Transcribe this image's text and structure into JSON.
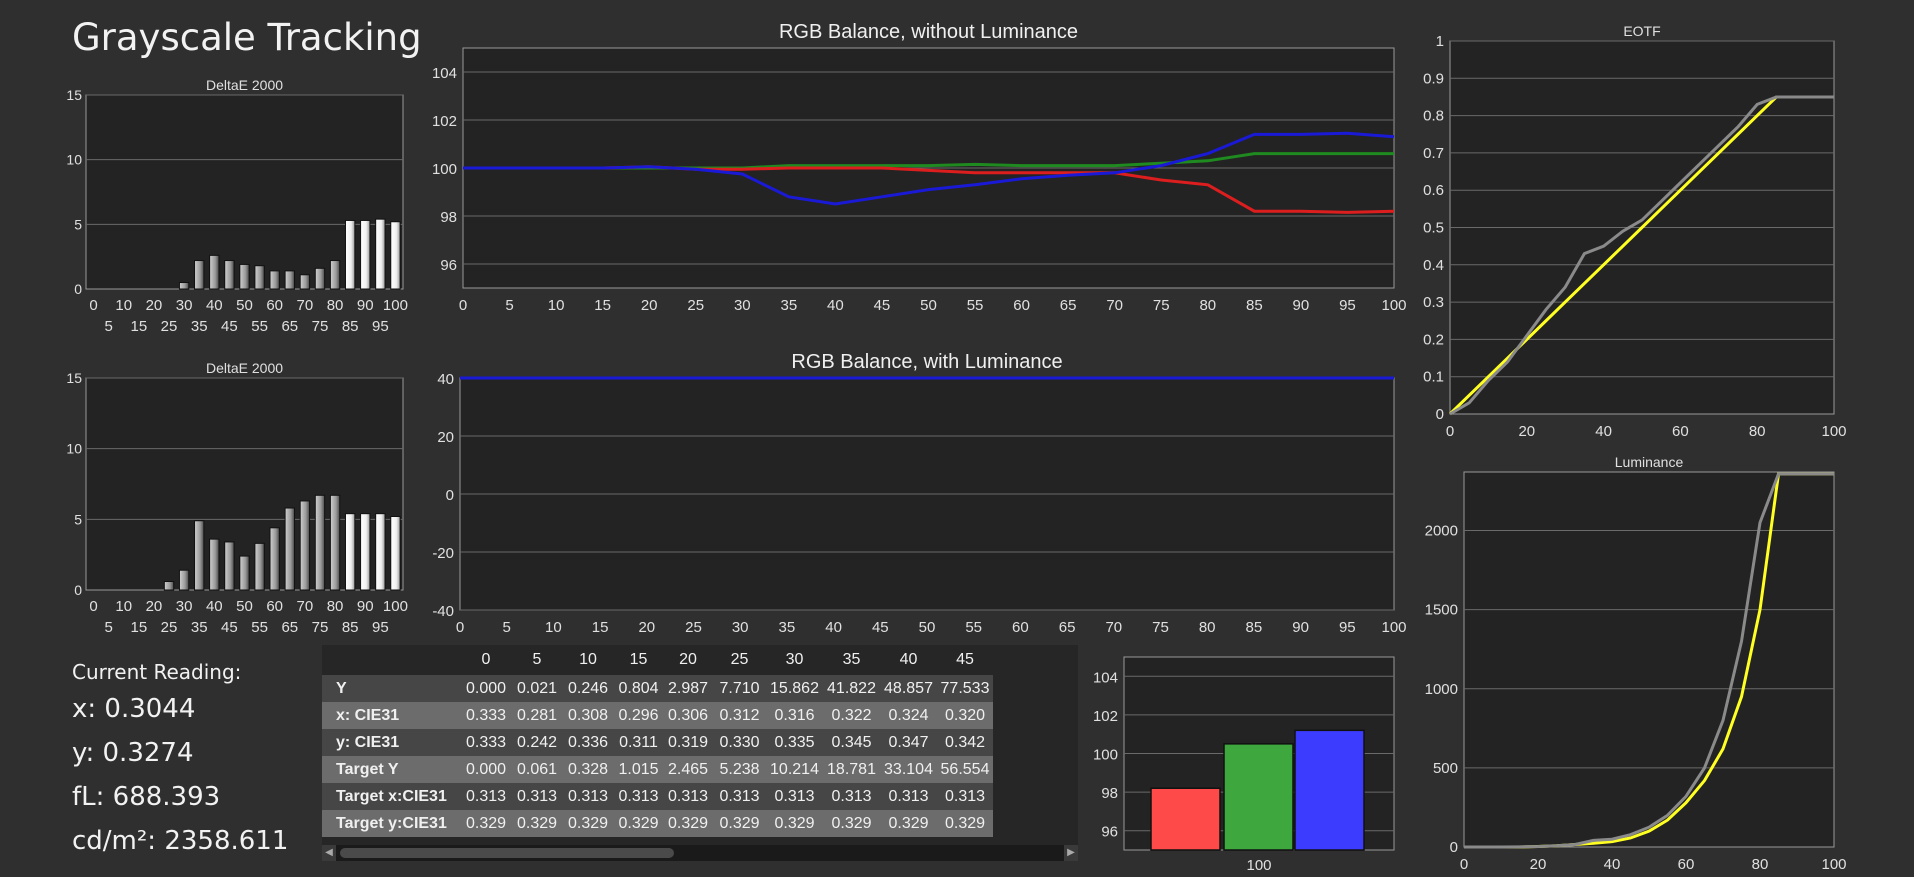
{
  "page_title": "Grayscale Tracking",
  "current_reading": {
    "header": "Current Reading:",
    "x": "x: 0.3044",
    "y": "y: 0.3274",
    "fl": "fL: 688.393",
    "cdm2": "cd/m²: 2358.611"
  },
  "table": {
    "columns": [
      "0",
      "5",
      "10",
      "15",
      "20",
      "25",
      "30",
      "35",
      "40",
      "45"
    ],
    "rows": [
      {
        "label": "Y",
        "values": [
          "0.000",
          "0.021",
          "0.246",
          "0.804",
          "2.987",
          "7.710",
          "15.862",
          "41.822",
          "48.857",
          "77.533"
        ]
      },
      {
        "label": "x: CIE31",
        "values": [
          "0.333",
          "0.281",
          "0.308",
          "0.296",
          "0.306",
          "0.312",
          "0.316",
          "0.322",
          "0.324",
          "0.320"
        ]
      },
      {
        "label": "y: CIE31",
        "values": [
          "0.333",
          "0.242",
          "0.336",
          "0.311",
          "0.319",
          "0.330",
          "0.335",
          "0.345",
          "0.347",
          "0.342"
        ]
      },
      {
        "label": "Target Y",
        "values": [
          "0.000",
          "0.061",
          "0.328",
          "1.015",
          "2.465",
          "5.238",
          "10.214",
          "18.781",
          "33.104",
          "56.554"
        ]
      },
      {
        "label": "Target x:CIE31",
        "values": [
          "0.313",
          "0.313",
          "0.313",
          "0.313",
          "0.313",
          "0.313",
          "0.313",
          "0.313",
          "0.313",
          "0.313"
        ]
      },
      {
        "label": "Target y:CIE31",
        "values": [
          "0.329",
          "0.329",
          "0.329",
          "0.329",
          "0.329",
          "0.329",
          "0.329",
          "0.329",
          "0.329",
          "0.329"
        ]
      }
    ]
  },
  "colors": {
    "red": "#dd1e1e",
    "green": "#1f8a1f",
    "blue": "#1a1ad6",
    "yellow": "#ffff22",
    "gray": "#8a8a8a",
    "plot_bg": "#232323",
    "grid": "#6a6a6a",
    "axis": "#9a9a9a"
  },
  "chart_data": [
    {
      "id": "deltae1",
      "type": "bar",
      "title": "DeltaE 2000",
      "categories": [
        0,
        5,
        10,
        15,
        20,
        25,
        30,
        35,
        40,
        45,
        50,
        55,
        60,
        65,
        70,
        75,
        80,
        85,
        90,
        95,
        100
      ],
      "values": [
        0,
        0,
        0,
        0,
        0,
        0,
        0.5,
        2.2,
        2.6,
        2.2,
        1.9,
        1.8,
        1.4,
        1.4,
        1.1,
        1.6,
        2.2,
        5.3,
        5.3,
        5.4,
        5.2
      ],
      "ylim": [
        0,
        15
      ],
      "yticks": [
        0,
        5,
        10,
        15
      ],
      "xticks_top": [
        "0",
        "10",
        "20",
        "30",
        "40",
        "50",
        "60",
        "70",
        "80",
        "90",
        "100"
      ],
      "xticks_bottom": [
        "5",
        "15",
        "25",
        "35",
        "45",
        "55",
        "65",
        "75",
        "85",
        "95"
      ]
    },
    {
      "id": "deltae2",
      "type": "bar",
      "title": "DeltaE 2000",
      "categories": [
        0,
        5,
        10,
        15,
        20,
        25,
        30,
        35,
        40,
        45,
        50,
        55,
        60,
        65,
        70,
        75,
        80,
        85,
        90,
        95,
        100
      ],
      "values": [
        0,
        0,
        0,
        0,
        0,
        0.6,
        1.4,
        4.9,
        3.6,
        3.4,
        2.4,
        3.3,
        4.4,
        5.8,
        6.3,
        6.7,
        6.7,
        5.4,
        5.4,
        5.4,
        5.2
      ],
      "ylim": [
        0,
        15
      ],
      "yticks": [
        0,
        5,
        10,
        15
      ],
      "xticks_top": [
        "0",
        "10",
        "20",
        "30",
        "40",
        "50",
        "60",
        "70",
        "80",
        "90",
        "100"
      ],
      "xticks_bottom": [
        "5",
        "15",
        "25",
        "35",
        "45",
        "55",
        "65",
        "75",
        "85",
        "95"
      ]
    },
    {
      "id": "rgb1",
      "type": "line",
      "title": "RGB Balance, without Luminance",
      "x": [
        0,
        5,
        10,
        15,
        20,
        25,
        30,
        35,
        40,
        45,
        50,
        55,
        60,
        65,
        70,
        75,
        80,
        85,
        90,
        95,
        100
      ],
      "xticks": [
        "0",
        "5",
        "10",
        "15",
        "20",
        "25",
        "30",
        "35",
        "40",
        "45",
        "50",
        "55",
        "60",
        "65",
        "70",
        "75",
        "80",
        "85",
        "90",
        "95",
        "100"
      ],
      "ylim": [
        95,
        105
      ],
      "yticks": [
        96,
        98,
        100,
        102,
        104
      ],
      "series": [
        {
          "color": "#1f8a1f",
          "values": [
            100,
            100,
            100,
            100,
            100,
            100,
            100,
            100.1,
            100.1,
            100.1,
            100.1,
            100.15,
            100.1,
            100.1,
            100.1,
            100.2,
            100.3,
            100.6,
            100.6,
            100.6,
            100.6
          ]
        },
        {
          "color": "#dd1e1e",
          "values": [
            100,
            100,
            100,
            100,
            100.05,
            99.95,
            99.95,
            100,
            100,
            100,
            99.9,
            99.8,
            99.8,
            99.8,
            99.8,
            99.5,
            99.3,
            98.2,
            98.2,
            98.15,
            98.2
          ]
        },
        {
          "color": "#1a1ad6",
          "values": [
            100,
            100,
            100,
            100,
            100.05,
            99.95,
            99.75,
            98.8,
            98.5,
            98.8,
            99.1,
            99.3,
            99.55,
            99.7,
            99.8,
            100.1,
            100.6,
            101.4,
            101.4,
            101.45,
            101.3
          ]
        }
      ]
    },
    {
      "id": "rgb2",
      "type": "line",
      "title": "RGB Balance, with Luminance",
      "x": [
        0,
        5,
        10,
        15,
        20,
        25,
        30,
        35,
        40,
        45,
        50,
        55,
        60,
        65,
        70,
        75,
        80,
        85,
        90,
        95,
        100
      ],
      "xticks": [
        "0",
        "5",
        "10",
        "15",
        "20",
        "25",
        "30",
        "35",
        "40",
        "45",
        "50",
        "55",
        "60",
        "65",
        "70",
        "75",
        "80",
        "85",
        "90",
        "95",
        "100"
      ],
      "ylim": [
        -40,
        40
      ],
      "yticks": [
        -40,
        -20,
        0,
        20,
        40
      ],
      "series": [
        {
          "color": "#1a1ad6",
          "values": [
            40,
            40,
            40,
            40,
            40,
            40,
            40,
            40,
            40,
            40,
            40,
            40,
            40,
            40,
            40,
            40,
            40,
            40,
            40,
            40,
            40
          ]
        }
      ]
    },
    {
      "id": "eotf",
      "type": "line",
      "title": "EOTF",
      "xlim": [
        0,
        100
      ],
      "ylim": [
        0,
        1
      ],
      "xticks": [
        "0",
        "20",
        "40",
        "60",
        "80",
        "100"
      ],
      "yticks": [
        "0",
        "0.1",
        "0.2",
        "0.3",
        "0.4",
        "0.5",
        "0.6",
        "0.7",
        "0.8",
        "0.9",
        "1"
      ],
      "series": [
        {
          "color": "#ffff22",
          "x": [
            0,
            5,
            10,
            15,
            20,
            25,
            30,
            35,
            40,
            45,
            50,
            55,
            60,
            65,
            70,
            75,
            80,
            85,
            90,
            95,
            100
          ],
          "values": [
            0,
            0.05,
            0.1,
            0.15,
            0.2,
            0.25,
            0.3,
            0.35,
            0.4,
            0.45,
            0.5,
            0.55,
            0.6,
            0.65,
            0.7,
            0.75,
            0.8,
            0.85,
            0.85,
            0.85,
            0.85
          ]
        },
        {
          "color": "#8a8a8a",
          "x": [
            0,
            5,
            10,
            15,
            20,
            25,
            30,
            35,
            40,
            45,
            50,
            55,
            60,
            65,
            70,
            75,
            80,
            85,
            90,
            95,
            100
          ],
          "values": [
            0,
            0.03,
            0.09,
            0.14,
            0.21,
            0.28,
            0.34,
            0.43,
            0.45,
            0.49,
            0.52,
            0.57,
            0.62,
            0.67,
            0.72,
            0.77,
            0.83,
            0.85,
            0.85,
            0.85,
            0.85
          ]
        }
      ]
    },
    {
      "id": "luminance",
      "type": "line",
      "title": "Luminance",
      "xlim": [
        0,
        100
      ],
      "ylim": [
        0,
        2370
      ],
      "xticks": [
        "0",
        "20",
        "40",
        "60",
        "80",
        "100"
      ],
      "yticks": [
        "0",
        "500",
        "1000",
        "1500",
        "2000"
      ],
      "series": [
        {
          "color": "#ffff22",
          "x": [
            0,
            5,
            10,
            15,
            20,
            25,
            30,
            35,
            40,
            45,
            50,
            55,
            60,
            65,
            70,
            75,
            80,
            85,
            90,
            95,
            100
          ],
          "values": [
            0,
            0,
            0,
            0,
            3,
            8,
            16,
            24,
            34,
            57,
            100,
            170,
            280,
            420,
            620,
            950,
            1500,
            2358,
            2358,
            2358,
            2358
          ]
        },
        {
          "color": "#8a8a8a",
          "x": [
            0,
            5,
            10,
            15,
            20,
            25,
            30,
            35,
            40,
            45,
            50,
            55,
            60,
            65,
            70,
            75,
            80,
            85,
            90,
            95,
            100
          ],
          "values": [
            0,
            0,
            0,
            1,
            3,
            8,
            16,
            42,
            49,
            78,
            125,
            200,
            320,
            500,
            800,
            1300,
            2050,
            2358,
            2358,
            2358,
            2358
          ]
        }
      ]
    },
    {
      "id": "rgbbar",
      "type": "bar",
      "title": "",
      "categories": [
        "100"
      ],
      "series": [
        {
          "color": "#ff4a4a",
          "value": 98.2
        },
        {
          "color": "#3ea83e",
          "value": 100.5
        },
        {
          "color": "#3c3cff",
          "value": 101.2
        }
      ],
      "ylim": [
        95,
        105
      ],
      "yticks": [
        96,
        98,
        100,
        102,
        104
      ]
    }
  ]
}
